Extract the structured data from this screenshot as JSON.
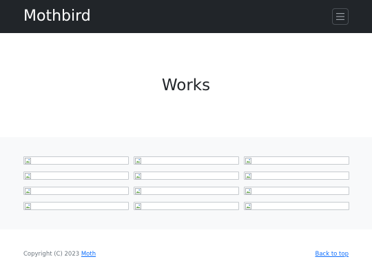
{
  "navbar": {
    "brand": "Mothbird",
    "menu_icon": "hamburger-menu-icon"
  },
  "hero": {
    "title": "Works"
  },
  "album": {
    "thumbnails": [
      {
        "icon": "broken-image-icon"
      },
      {
        "icon": "broken-image-icon"
      },
      {
        "icon": "broken-image-icon"
      },
      {
        "icon": "broken-image-icon"
      },
      {
        "icon": "broken-image-icon"
      },
      {
        "icon": "broken-image-icon"
      },
      {
        "icon": "broken-image-icon"
      },
      {
        "icon": "broken-image-icon"
      },
      {
        "icon": "broken-image-icon"
      },
      {
        "icon": "broken-image-icon"
      },
      {
        "icon": "broken-image-icon"
      },
      {
        "icon": "broken-image-icon"
      }
    ]
  },
  "footer": {
    "copyright_text": "Copyright (C) 2023",
    "author_link": "Moth",
    "back_to_top": "Back to top"
  },
  "colors": {
    "navbar_bg": "#212529",
    "album_bg": "#f8f9fa",
    "link": "#0d6efd"
  }
}
